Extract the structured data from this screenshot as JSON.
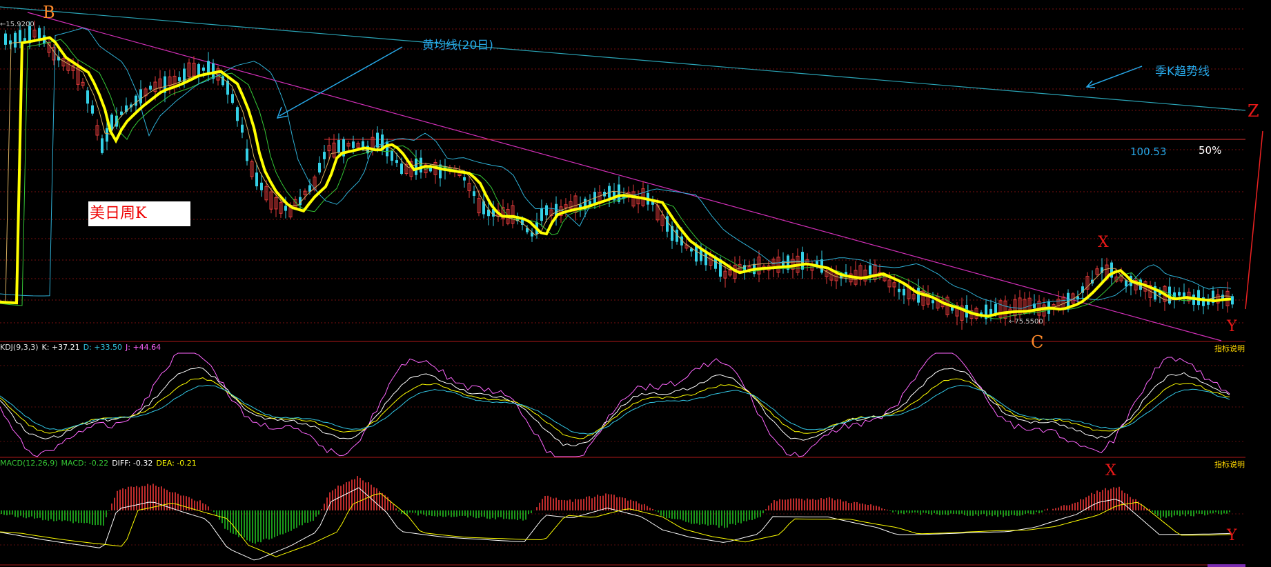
{
  "chart_data": [
    {
      "type": "candlestick",
      "panel": "price",
      "title": "美日周K",
      "annotations": {
        "ma_note": "黄均线(20日)",
        "trend_note": "季K趋势线",
        "level_value": "100.53",
        "level_pct": "50%",
        "high_label": "15.9200",
        "low_label": "75.5500",
        "points": [
          "B",
          "C",
          "X",
          "Y",
          "Z"
        ]
      },
      "moving_averages": [
        "MA(20) yellow",
        "white",
        "green",
        "cyan"
      ],
      "colors": {
        "up": "#e33b3b",
        "down": "#34d0e6",
        "ma20": "#ffff00",
        "ma_fast": "#ffffff",
        "ma_mid": "#35c735",
        "ma_slow": "#2fb0d6",
        "trendline": "#d22fb8",
        "long_trend": "#2aa4b6",
        "level": "#c33"
      }
    },
    {
      "type": "line",
      "panel": "kdj",
      "name": "KDJ(9,3,3)",
      "values": {
        "K": "+37.21",
        "D": "+33.50",
        "J": "+44.64"
      },
      "explain": "指标说明",
      "colors": {
        "K": "#ffffff",
        "D": "#ffff00",
        "J": "#ff66ff",
        "extra": "#32c8e6"
      }
    },
    {
      "type": "bar",
      "panel": "macd",
      "name": "MACD(12,26,9)",
      "values": {
        "MACD": "-0.22",
        "DIFF": "-0.32",
        "DEA": "-0.21"
      },
      "explain": "指标说明",
      "colors": {
        "pos": "#ff3b3b",
        "neg": "#22cc22",
        "DIFF": "#ffffff",
        "DEA": "#ffff00"
      }
    }
  ],
  "labels": {
    "kdj_prefix": "KDJ(9,3,3)",
    "kdj_k": "K: +37.21",
    "kdj_d": "D: +33.50",
    "kdj_j": "J: +44.64",
    "macd_prefix": "MACD(12,26,9)",
    "macd_m": "MACD: -0.22",
    "macd_diff": "DIFF: -0.32",
    "macd_dea": "DEA: -0.21"
  }
}
